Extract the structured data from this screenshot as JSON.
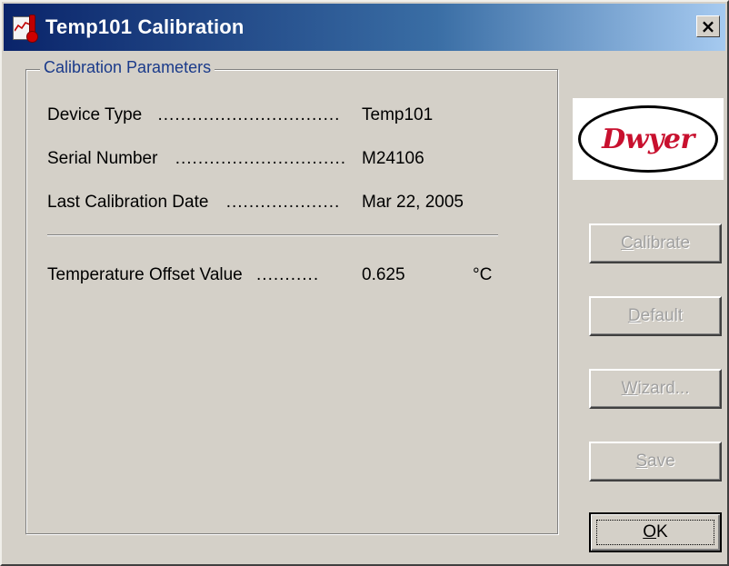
{
  "window": {
    "title": "Temp101 Calibration",
    "close_symbol": "×",
    "icon": "thermometer-chart-icon"
  },
  "group": {
    "legend": "Calibration Parameters",
    "rows": [
      {
        "label": "Device Type",
        "dots": "................................",
        "value": "Temp101"
      },
      {
        "label": "Serial Number",
        "dots": "..............................",
        "value": "M24106"
      },
      {
        "label": "Last Calibration Date",
        "dots": "....................",
        "value": "Mar 22, 2005"
      }
    ],
    "offset": {
      "label": "Temperature Offset Value",
      "dots": "...........",
      "value": "0.625",
      "unit": "°C"
    }
  },
  "logo": {
    "text": "Dwyer"
  },
  "buttons": [
    {
      "pre": "",
      "mnemonic": "C",
      "post": "alibrate",
      "enabled": false
    },
    {
      "pre": "",
      "mnemonic": "D",
      "post": "efault",
      "enabled": false
    },
    {
      "pre": "",
      "mnemonic": "W",
      "post": "izard...",
      "enabled": false
    },
    {
      "pre": "",
      "mnemonic": "S",
      "post": "ave",
      "enabled": false
    },
    {
      "pre": "",
      "mnemonic": "O",
      "post": "K",
      "enabled": true
    }
  ],
  "colors": {
    "title_gradient_start": "#0a246a",
    "dialog_face": "#d4d0c8",
    "legend_text": "#1a3a8a",
    "logo_red": "#c8102e"
  }
}
